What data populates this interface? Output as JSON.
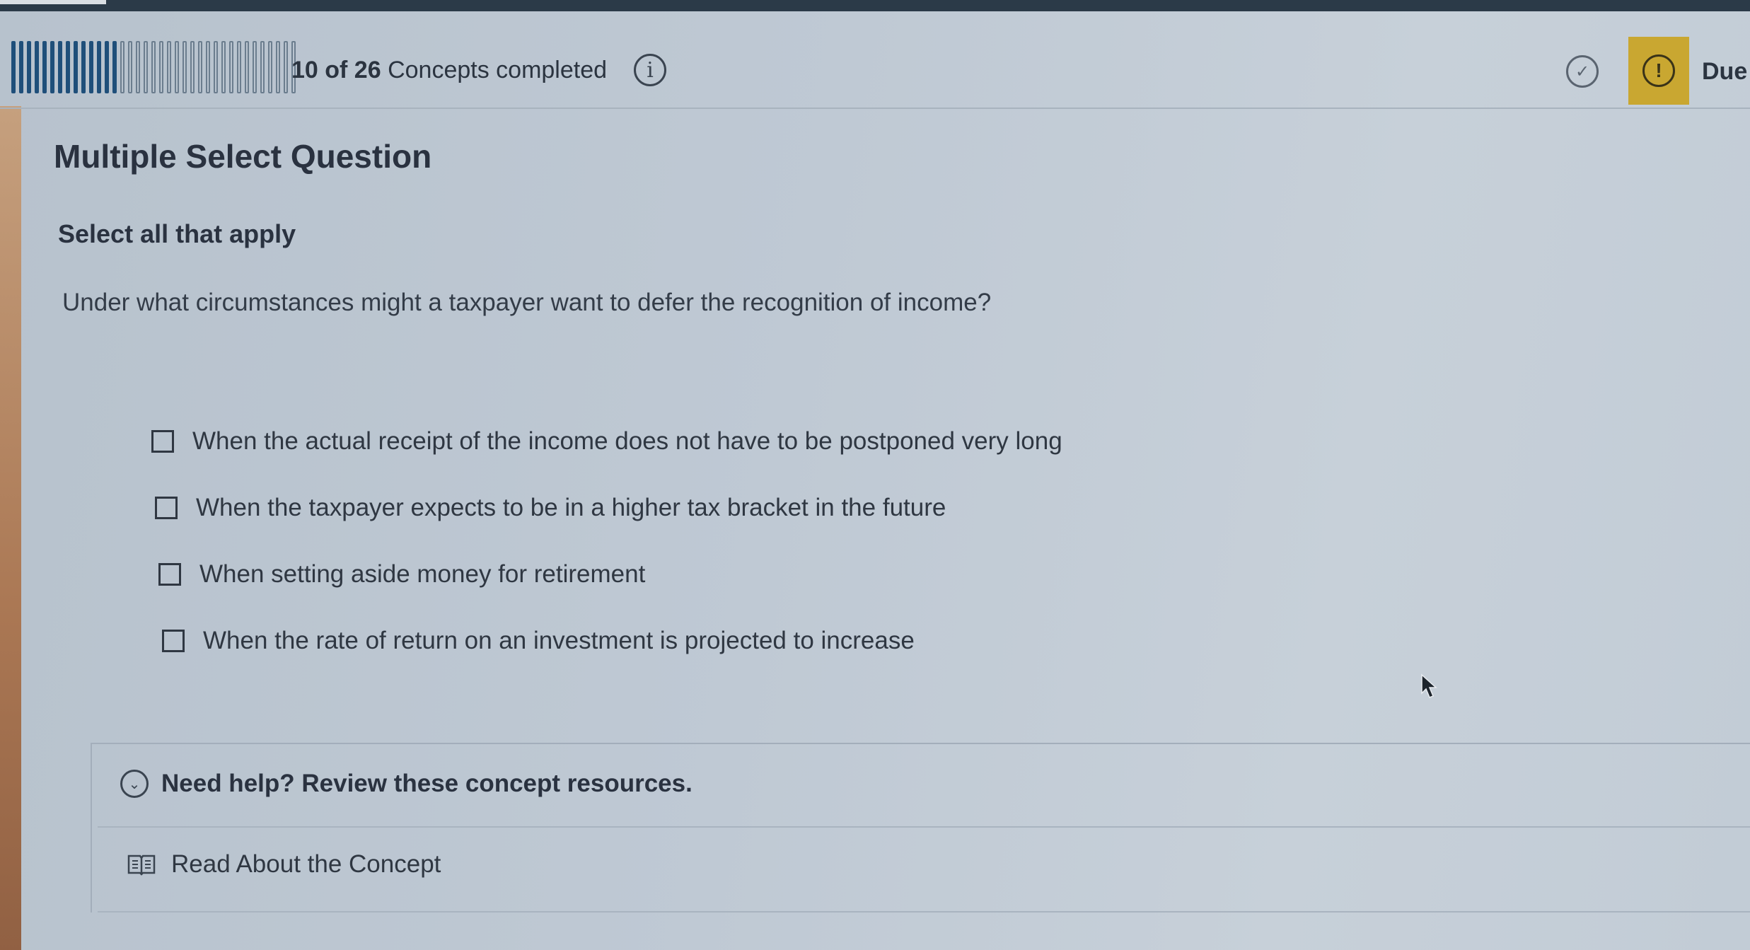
{
  "header": {
    "progress": {
      "completed": 10,
      "total": 26
    },
    "progress_completed": "10 of 26",
    "progress_suffix": " Concepts completed",
    "info_icon": "info-icon",
    "check_icon": "check-circle-icon",
    "alert_icon": "alert-icon",
    "due_label": "Due"
  },
  "question": {
    "type_title": "Multiple Select Question",
    "instruction": "Select all that apply",
    "prompt": "Under what circumstances might a taxpayer want to defer the recognition of income?",
    "options": [
      {
        "label": "When the actual receipt of the income does not have to be postponed very long",
        "checked": false
      },
      {
        "label": "When the taxpayer expects to be in a higher tax bracket in the future",
        "checked": false
      },
      {
        "label": "When setting aside money for retirement",
        "checked": false
      },
      {
        "label": "When the rate of return on an investment is projected to increase",
        "checked": false
      }
    ]
  },
  "help": {
    "toggle_label": "Need help? Review these concept resources.",
    "toggle_icon": "chevron-down-icon",
    "resource_label": "Read About the Concept",
    "resource_icon": "book-icon"
  },
  "colors": {
    "progress_done": "#1f4f7a",
    "alert_bg": "#c9a731",
    "background": "#bfc9d4"
  }
}
